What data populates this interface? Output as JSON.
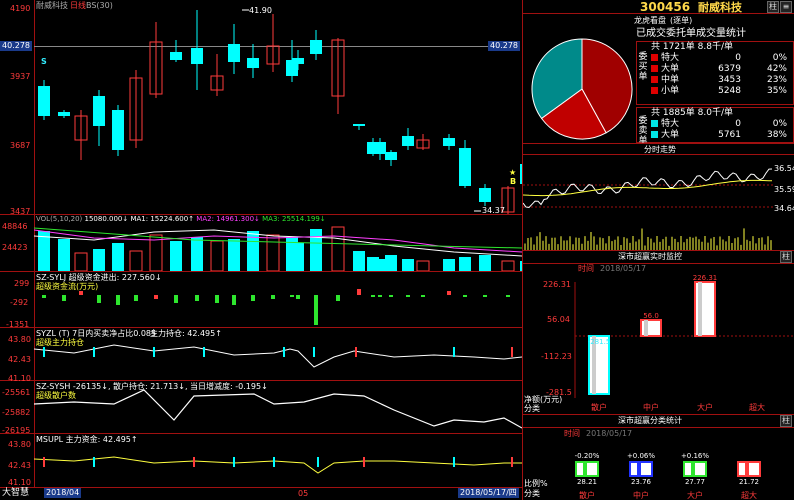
{
  "main": {
    "title": "耐威科技",
    "period": "日线",
    "indicator": "BS(30)",
    "price_axis": [
      "4190",
      "3937",
      "3687",
      "3437"
    ],
    "crosshair_price": "40.278",
    "high_label": "41.90",
    "low_label": "34.37",
    "signal_s": "S",
    "signal_b": "B",
    "star": "★"
  },
  "volume": {
    "header_name": "VOL(5,10,20)",
    "header_value": "15080.000↓",
    "ma1": "MA1: 15224.600↑",
    "ma2": "MA2: 14961.300↓",
    "ma3": "MA3: 25514.199↓",
    "axis": [
      "48846",
      "24423"
    ]
  },
  "capital": {
    "title": "SZ-SYLJ 超级资金进出: 227.560↓",
    "subtitle": "超级资金流(万元)",
    "axis": [
      "299",
      "-292",
      "-1351"
    ]
  },
  "main_ratio": {
    "title_left": "SYZL (T) 7日内买卖净占比0.085",
    "title_right": "主力持仓: 42.495↑",
    "subtitle": "超级主力持仓",
    "axis": [
      "43.80",
      "42.43",
      "41.10"
    ]
  },
  "retail": {
    "title": "SZ-SYSH -26135↓, 散户持仓: 21.713↓, 当日增减度: -0.195↓",
    "subtitle": "超级散户数",
    "axis": [
      "-25561",
      "-25882",
      "-26195"
    ]
  },
  "main_fund": {
    "title": "MSUPL 主力资金: 42.495↑",
    "axis": [
      "43.80",
      "42.43",
      "41.10"
    ]
  },
  "bottom_bar": {
    "brand": "大智慧",
    "date_left": "2018/04",
    "date_mid": "05",
    "date_right": "2018/05/17/四"
  },
  "stock": {
    "code": "300456",
    "name": "耐威科技",
    "btn1": "柱",
    "btn2": "≡"
  },
  "dragon": {
    "title": "龙虎看盘",
    "mode": "(逐单)",
    "desc": "已成交委托单成交量统计",
    "buy_label": "委买单",
    "sell_label": "委卖单",
    "buy_header": "共 1721单 8.8千/单",
    "sell_header": "共 1885单 8.0千/单",
    "buy_rows": [
      {
        "name": "特大",
        "qty": "0",
        "pct": "0%",
        "color": "#e00000"
      },
      {
        "name": "大单",
        "qty": "6379",
        "pct": "42%",
        "color": "#e00000"
      },
      {
        "name": "中单",
        "qty": "3453",
        "pct": "23%",
        "color": "#e00000"
      },
      {
        "name": "小单",
        "qty": "5248",
        "pct": "35%",
        "color": "#e00000"
      }
    ],
    "sell_rows": [
      {
        "name": "特大",
        "qty": "0",
        "pct": "0%",
        "color": "#00e6e6"
      },
      {
        "name": "大单",
        "qty": "5761",
        "pct": "38%",
        "color": "#00e6e6"
      }
    ]
  },
  "minute": {
    "title": "分时走势",
    "axis": [
      "36.54",
      "35.59",
      "34.64"
    ]
  },
  "realtime": {
    "title": "深市超赢实时监控",
    "time_label": "时间",
    "date": "2018/05/17",
    "axis": [
      "226.31",
      "56.04",
      "-112.23",
      "-281.5"
    ],
    "y_title": "净额(万元)",
    "x_title": "分类",
    "categories": [
      "散户",
      "中户",
      "大户",
      "超大"
    ],
    "bar_labels": [
      "-281.5",
      "56.0",
      "226.31"
    ]
  },
  "stats": {
    "title": "深市超赢分类统计",
    "time_label": "时间",
    "date": "2018/05/17",
    "y_title": "比例%",
    "x_title": "分类",
    "categories": [
      "散户",
      "中户",
      "大户",
      "超大"
    ],
    "top_labels": [
      "-0.20%",
      "+0.06%",
      "+0.16%",
      ""
    ],
    "values": [
      "28.21",
      "23.76",
      "27.77",
      "21.72"
    ]
  },
  "colors": {
    "up": "#ff3b3b",
    "down": "#00ffff",
    "border": "#a01010",
    "accent": "#ffff40"
  }
}
